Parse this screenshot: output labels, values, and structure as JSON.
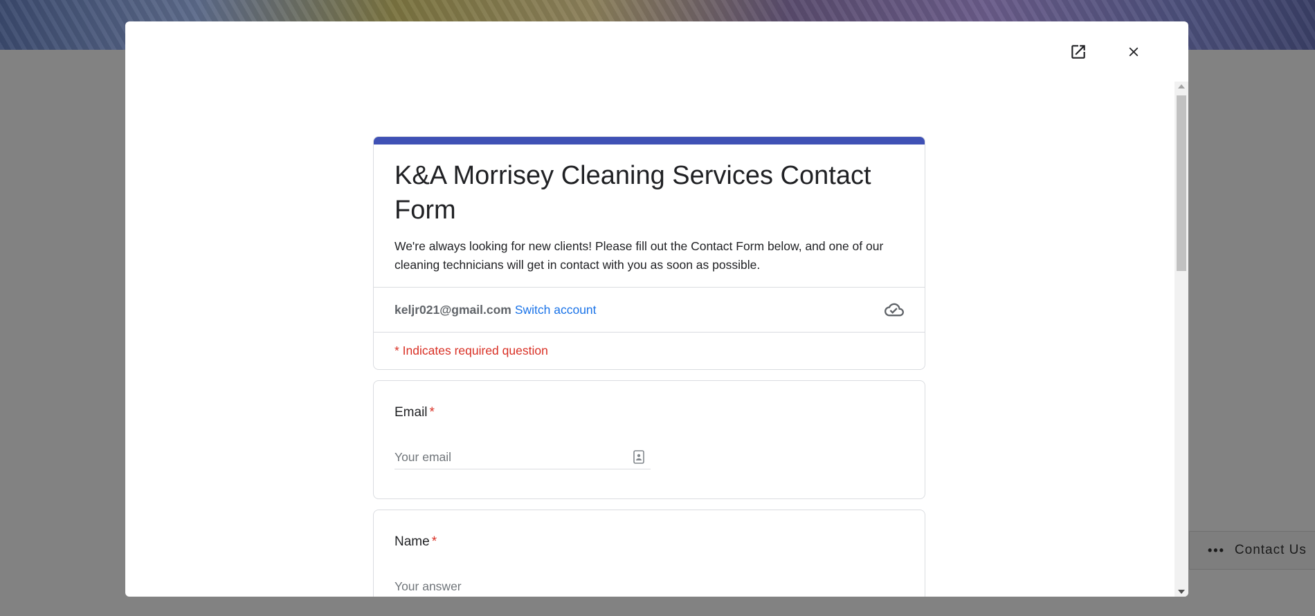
{
  "background": {
    "contact_tab_label": "Contact Us",
    "contact_tab_dots": "•••"
  },
  "modal": {
    "open_in_new_icon": "open-in-new-icon",
    "close_icon": "close-icon"
  },
  "form": {
    "title": "K&A Morrisey Cleaning Services Contact Form",
    "description": "We're always looking for new clients! Please fill out the Contact Form below, and one of our cleaning technicians will get in contact with you as soon as possible.",
    "account_email": "keljr021@gmail.com",
    "switch_account": "Switch account",
    "required_note": "* Indicates required question",
    "accent_color": "#3f51b5",
    "questions": [
      {
        "label": "Email",
        "required_mark": "*",
        "placeholder": "Your email"
      },
      {
        "label": "Name",
        "required_mark": "*",
        "placeholder": "Your answer"
      }
    ]
  }
}
